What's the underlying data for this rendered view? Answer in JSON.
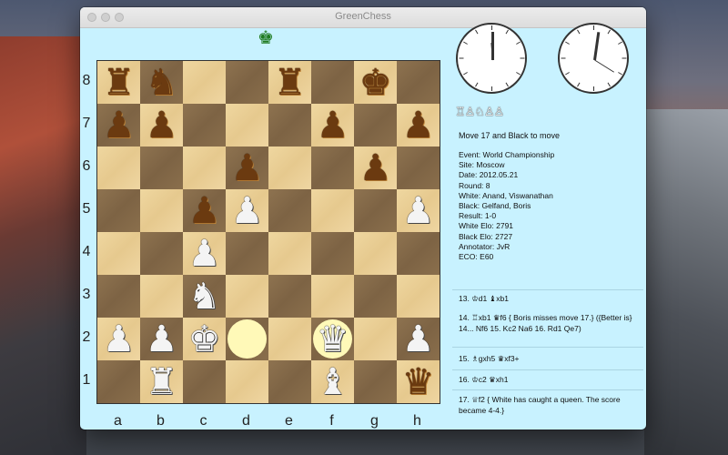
{
  "window": {
    "title": "GreenChess"
  },
  "turn_indicator_icon": "white-king-icon",
  "board": {
    "files": [
      "a",
      "b",
      "c",
      "d",
      "e",
      "f",
      "g",
      "h"
    ],
    "ranks": [
      "8",
      "7",
      "6",
      "5",
      "4",
      "3",
      "2",
      "1"
    ],
    "pieces": {
      "a8": "br",
      "b8": "bn",
      "e8": "br",
      "g8": "bk",
      "a7": "bp",
      "b7": "bp",
      "f7": "bp",
      "h7": "bp",
      "d6": "bp",
      "g6": "bp",
      "c5": "bp",
      "d5": "wp",
      "h5": "wp",
      "c4": "wp",
      "c3": "wn",
      "a2": "wp",
      "b2": "wp",
      "c2": "wk",
      "f2": "wq",
      "h2": "wp",
      "b1": "wr",
      "f1": "wb",
      "h1": "bq"
    },
    "highlighted_squares": [
      "d2",
      "f2"
    ]
  },
  "clocks": [
    {
      "name": "white-clock"
    },
    {
      "name": "black-clock"
    }
  ],
  "captured": "♖♙♘♙♙",
  "move_status": "Move 17 and Black to move",
  "game_info": [
    {
      "label": "Event:",
      "value": "World Championship"
    },
    {
      "label": "Site:",
      "value": "Moscow"
    },
    {
      "label": "Date:",
      "value": "2012.05.21"
    },
    {
      "label": "Round:",
      "value": "8"
    },
    {
      "label": "White:",
      "value": "Anand, Viswanathan"
    },
    {
      "label": "Black:",
      "value": "Gelfand, Boris"
    },
    {
      "label": "Result:",
      "value": "1-0"
    },
    {
      "label": "White Elo:",
      "value": "2791"
    },
    {
      "label": "Black Elo:",
      "value": "2727"
    },
    {
      "label": "Annotator:",
      "value": "JvR"
    },
    {
      "label": "ECO:",
      "value": "E60"
    }
  ],
  "moves": [
    "13. ♔d1  ♝xb1",
    "14. ♖xb1  ♛f6 { Boris misses move 17.} ({Better is} 14... Nf6 15. Kc2 Na6 16. Rd1 Qe7)",
    "15. ♗gxh5  ♛xf3+",
    "16. ♔c2  ♛xh1",
    "17. ♕f2 { White has caught a queen. The score became 4-4.}"
  ]
}
